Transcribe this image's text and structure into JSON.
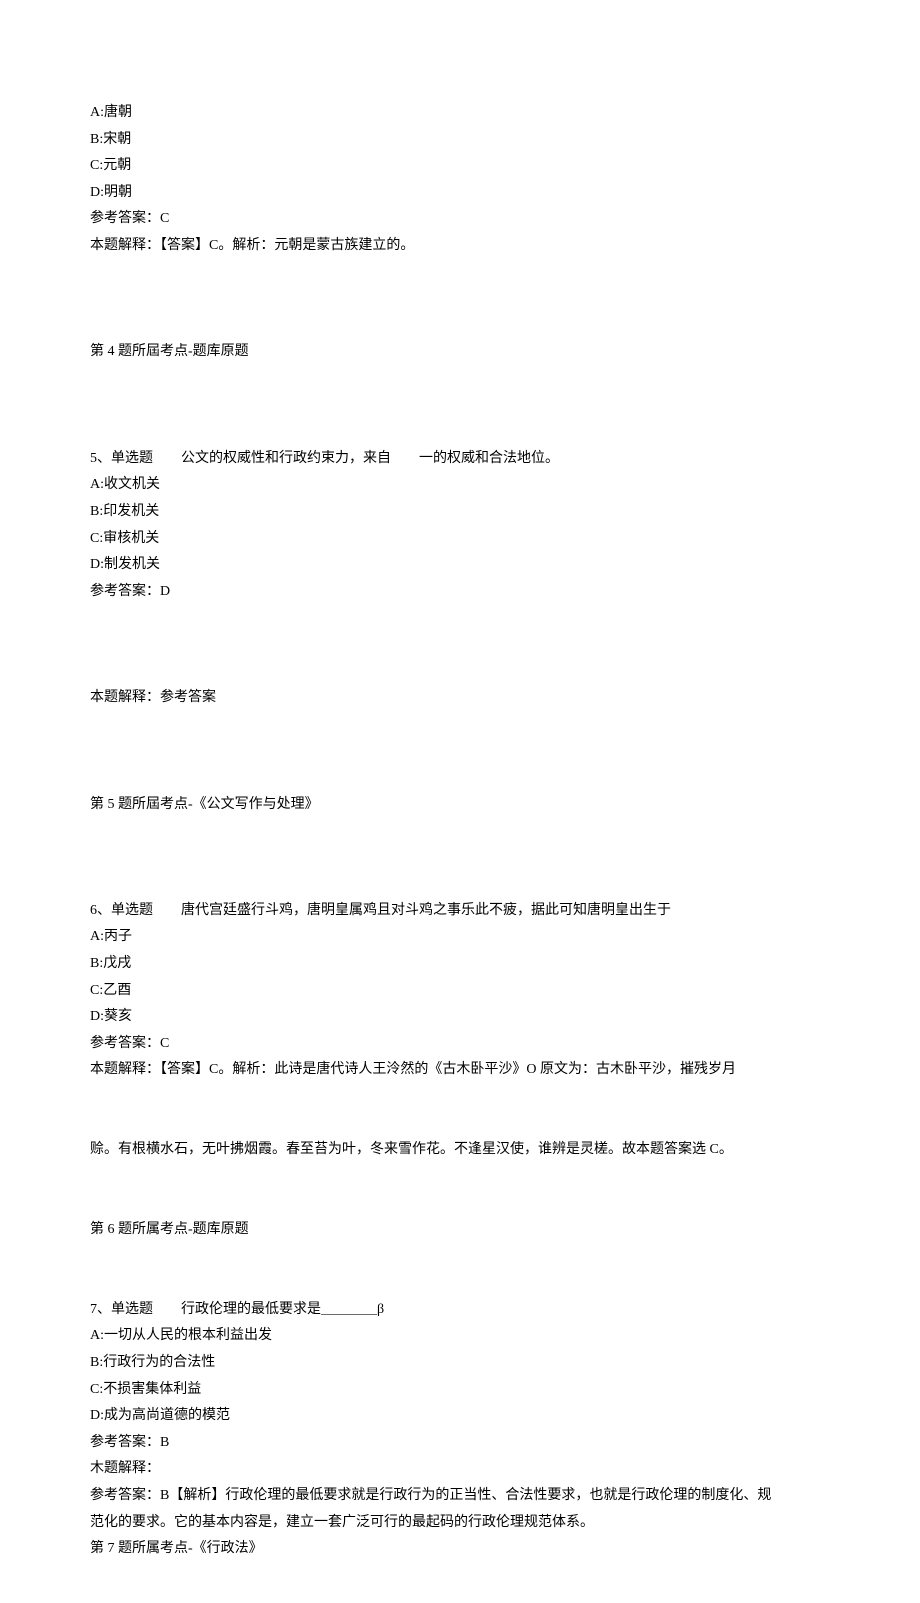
{
  "q4": {
    "optA": "A:唐朝",
    "optB": "B:宋朝",
    "optC": "C:元朝",
    "optD": "D:明朝",
    "ansLabel": "参考答案：C",
    "explain": "本题解释：【答案】C。解析：元朝是蒙古族建立的。",
    "topic": "第 4 题所屆考点-题库原题"
  },
  "q5": {
    "stem": "5、单选题　　公文的权威性和行政约束力，来自　　一的权威和合法地位。",
    "optA": "A:收文机关",
    "optB": "B:印发机关",
    "optC": "C:审核机关",
    "optD": "D:制发机关",
    "ansLabel": "参考答案：D",
    "explain": "本题解释：参考答案",
    "topic": "第 5 题所屆考点-《公文写作与处理》"
  },
  "q6": {
    "stem": "6、单选题　　唐代宫廷盛行斗鸡，唐明皇属鸡且对斗鸡之事乐此不疲，据此可知唐明皇出生于",
    "optA": "A:丙子",
    "optB": "B:戊戌",
    "optC": "C:乙酉",
    "optD": "D:葵亥",
    "ansLabel": "参考答案：C",
    "explainPart1": "本题解释：【答案】C。解析：此诗是唐代诗人王泠然的《古木卧平沙》O 原文为：古木卧平沙，摧残岁月",
    "explainPart2": "赊。有根横水石，无叶拂烟霞。春至苔为叶，冬来雪作花。不逢星汉使，谁辨是灵槎。故本题答案选 C。",
    "topic": "第 6 题所属考点-题库原题"
  },
  "q7": {
    "stem": "7、单选题　　行政伦理的最低要求是＿＿＿＿β",
    "optA": "A:一切从人民的根本利益出发",
    "optB": "B:行政行为的合法性",
    "optC": "C:不损害集体利益",
    "optD": "D:成为高尚道德的模范",
    "ansLabel": "参考答案：B",
    "explainLabel": "木题解释：",
    "explainPart1": "参考答案：B【解析】行政伦理的最低要求就是行政行为的正当性、合法性要求，也就是行政伦理的制度化、规",
    "explainPart2": "范化的要求。它的基本内容是，建立一套广泛可行的最起码的行政伦理规范体系。",
    "topic": "第 7 题所属考点-《行政法》"
  }
}
